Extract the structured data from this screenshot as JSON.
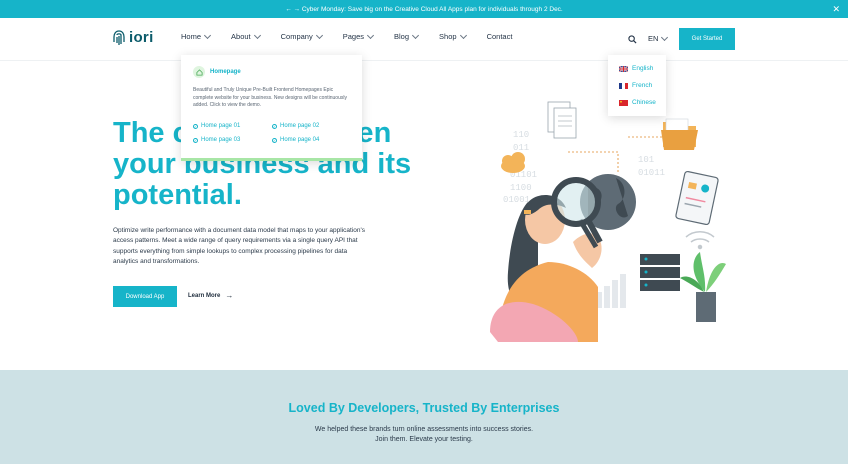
{
  "promo": {
    "text": "← → Cyber Monday: Save big on the Creative Cloud All Apps plan for individuals through 2 Dec."
  },
  "header": {
    "logo_text": "iori",
    "nav": [
      {
        "label": "Home",
        "has_caret": true
      },
      {
        "label": "About",
        "has_caret": true
      },
      {
        "label": "Company",
        "has_caret": true
      },
      {
        "label": "Pages",
        "has_caret": true
      },
      {
        "label": "Blog",
        "has_caret": true
      },
      {
        "label": "Shop",
        "has_caret": true
      },
      {
        "label": "Contact",
        "has_caret": false
      }
    ],
    "language": "EN",
    "cta": "Get Started"
  },
  "home_dropdown": {
    "title": "Homepage",
    "description": "Beautiful and Truly Unique Pre-Built Frontend Homepages Epic complete website for your business. New designs will be continuously added. Click to view the demo.",
    "links": [
      "Home page 01",
      "Home page 02",
      "Home page 03",
      "Home page 04"
    ]
  },
  "language_dropdown": {
    "options": [
      {
        "label": "English",
        "flag": "uk-flag-icon"
      },
      {
        "label": "French",
        "flag": "france-flag-icon"
      },
      {
        "label": "Chinese",
        "flag": "china-flag-icon"
      }
    ]
  },
  "hero": {
    "title_line1": "The c",
    "title_line1_end": "ween",
    "title_line2": "your business and its",
    "title_line3": "potential.",
    "description": "Optimize write performance with a document data model that maps to your application's access patterns. Meet a wide range of query requirements via a single query API that supports everything from simple lookups to complex processing pipelines for data analytics and transformations.",
    "primary_button": "Download App",
    "secondary_link": "Learn More"
  },
  "brands": {
    "title": "Loved By Developers, Trusted By Enterprises",
    "subtitle_line1": "We helped these brands turn online assessments into success stories.",
    "subtitle_line2": "Join them. Elevate your testing."
  },
  "colors": {
    "accent": "#16b4c9",
    "band": "#cde1e5",
    "dark_teal": "#0c5c6b"
  }
}
